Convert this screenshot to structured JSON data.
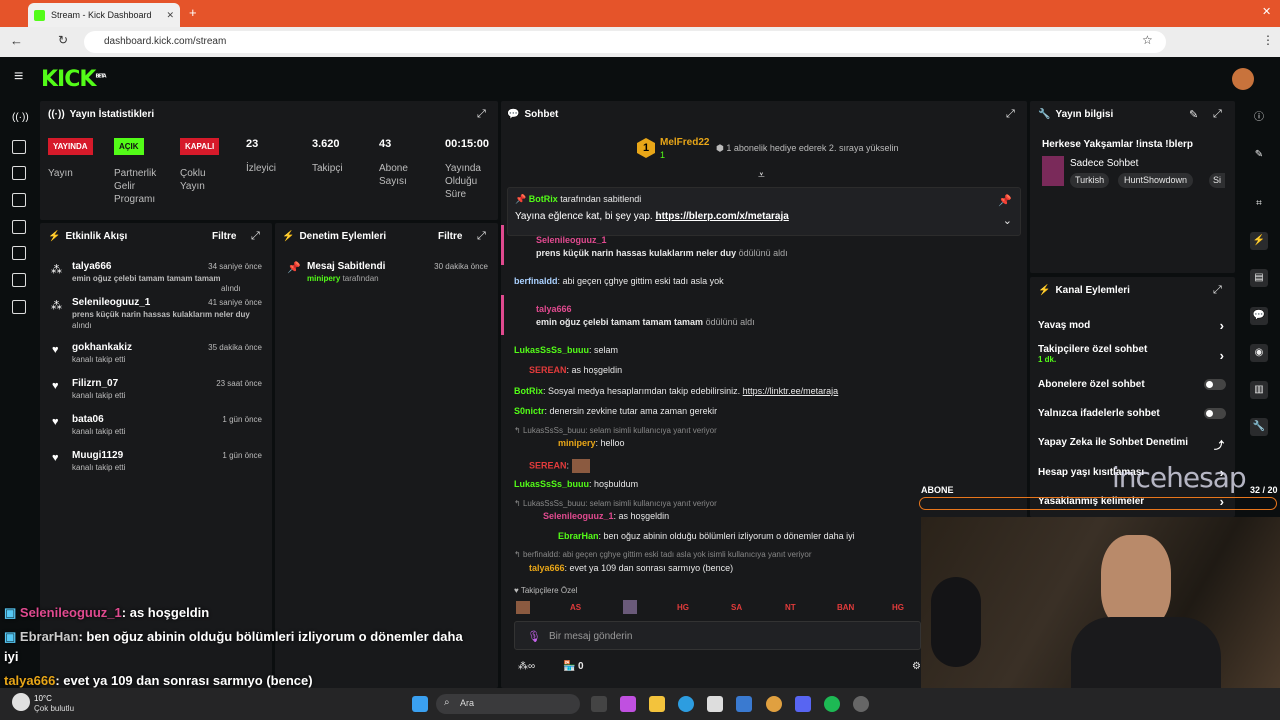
{
  "browser": {
    "tab_title": "Stream - Kick Dashboard",
    "url": "dashboard.kick.com/stream"
  },
  "brand": {
    "logo": "KICK",
    "beta": "BETA",
    "accent": "#53fc18"
  },
  "stats": {
    "title": "Yayın İstatistikleri",
    "items": [
      {
        "badge": "YAYINDA",
        "label": "Yayın"
      },
      {
        "badge": "AÇIK",
        "label": "Partnerlik Gelir Programı"
      },
      {
        "badge": "KAPALI",
        "label": "Çoklu Yayın"
      },
      {
        "value": "23",
        "label": "İzleyici"
      },
      {
        "value": "3.620",
        "label": "Takipçi"
      },
      {
        "value": "43",
        "label": "Abone Sayısı"
      },
      {
        "value": "00:15:00",
        "label": "Yayında Olduğu Süre"
      }
    ]
  },
  "activity": {
    "title": "Etkinlik Akışı",
    "filter": "Filtre",
    "items": [
      {
        "name": "talya666",
        "time": "34 saniye önce",
        "line1": "emin oğuz çelebi tamam tamam tamam",
        "line2": "alındı"
      },
      {
        "name": "Selenileoguuz_1",
        "time": "41 saniye önce",
        "line1": "prens küçük narin hassas kulaklarım neler duy",
        "line2": "alındı"
      },
      {
        "name": "gokhankakiz",
        "time": "35 dakika önce",
        "line2": "kanalı takip etti"
      },
      {
        "name": "Filizrn_07",
        "time": "23 saat önce",
        "line2": "kanalı takip etti"
      },
      {
        "name": "bata06",
        "time": "1 gün önce",
        "line2": "kanalı takip etti"
      },
      {
        "name": "Muugi1129",
        "time": "1 gün önce",
        "line2": "kanalı takip etti"
      }
    ]
  },
  "moderation": {
    "title": "Denetim Eylemleri",
    "filter": "Filtre",
    "item": {
      "title": "Mesaj Sabitlendi",
      "time": "30 dakika önce",
      "user": "minipery",
      "suffix": "tarafından"
    }
  },
  "chat": {
    "title": "Sohbet",
    "top_gifter": {
      "name": "MelFred22",
      "rank": "1",
      "count": "1",
      "note": "1 abonelik hediye ederek 2. sıraya yükselin"
    },
    "pinned": {
      "by": "BotRix",
      "by_suffix": "tarafından sabitlendi",
      "text": "Yayına eğlence kat, bi şey yap.",
      "link": "https://blerp.com/x/metaraja"
    },
    "messages": [
      {
        "user": "Selenileoguuz_1",
        "text": "prens küçük narin hassas kulaklarım neler duy",
        "suffix": "ödülünü aldı"
      },
      {
        "user": "berfinaldd",
        "text": "abi geçen çghye gittim eski tadı asla yok"
      },
      {
        "user": "talya666",
        "text": "emin oğuz çelebi tamam tamam tamam",
        "suffix": "ödülünü aldı"
      },
      {
        "user": "LukasSsSs_buuu",
        "text": "selam"
      },
      {
        "user": "SEREAN",
        "text": "as hoşgeldin"
      },
      {
        "user": "BotRix",
        "text": "Sosyal medya hesaplarımdan takip edebilirsiniz.",
        "link": "https://linktr.ee/metaraja"
      },
      {
        "user": "S0nictr",
        "text": "denersin zevkine tutar ama zaman gerekir"
      },
      {
        "reply": "LukasSsSs_buuu: selam isimli kullanıcıya yanıt veriyor",
        "user": "minipery",
        "text": "helloo"
      },
      {
        "user": "SEREAN",
        "text": ""
      },
      {
        "user": "LukasSsSs_buuu",
        "text": "hoşbuldum"
      },
      {
        "reply": "LukasSsSs_buuu: selam isimli kullanıcıya yanıt veriyor",
        "user": "Selenileoguuz_1",
        "text": "as hoşgeldin"
      },
      {
        "user": "EbrarHan",
        "text": "ben oğuz abinin olduğu bölümleri izliyorum o dönemler daha iyi"
      },
      {
        "reply": "berfinaldd: abi geçen çghye gittim eski tadı asla yok isimli kullanıcıya yanıt veriyor",
        "user": "talya666",
        "text": "evet ya 109 dan sonrası sarmıyo (bence)"
      }
    ],
    "followers_only": "Takipçilere Özel",
    "emotes": [
      "AS",
      "HG",
      "SA",
      "NT",
      "BAN",
      "HG"
    ],
    "input_placeholder": "Bir mesaj gönderin",
    "footer_count": "0"
  },
  "info": {
    "title": "Yayın bilgisi",
    "stream_title": "Herkese Yakşamlar !insta !blerp",
    "category": "Sadece Sohbet",
    "tags": [
      "Turkish",
      "HuntShowdown",
      "Si"
    ]
  },
  "channel": {
    "title": "Kanal Eylemleri",
    "items": [
      "Yavaş mod",
      "Takipçilere özel sohbet",
      "Abonelere özel sohbet",
      "Yalnızca ifadelerle sohbet",
      "Yapay Zeka ile Sohbet Denetimi",
      "Hesap yaşı kısıtlaması",
      "Yasaklanmış kelimeler"
    ],
    "followers_sub": "1 dk."
  },
  "overlay": {
    "abone": "ABONE",
    "abone_count": "32 / 20",
    "watermark": "incehesap",
    "lines": [
      {
        "user": "Selenileoguuz_1",
        "text": ": as hoşgeldin"
      },
      {
        "user": "EbrarHan",
        "text": ": ben oğuz abinin olduğu bölümleri izliyorum o dönemler daha"
      },
      {
        "user": "",
        "text": "iyi"
      },
      {
        "user": "talya666",
        "text": ": evet ya 109 dan sonrası sarmıyo (bence)"
      }
    ]
  },
  "taskbar": {
    "temp": "10°C",
    "weather": "Çok bulutlu",
    "search": "Ara"
  }
}
